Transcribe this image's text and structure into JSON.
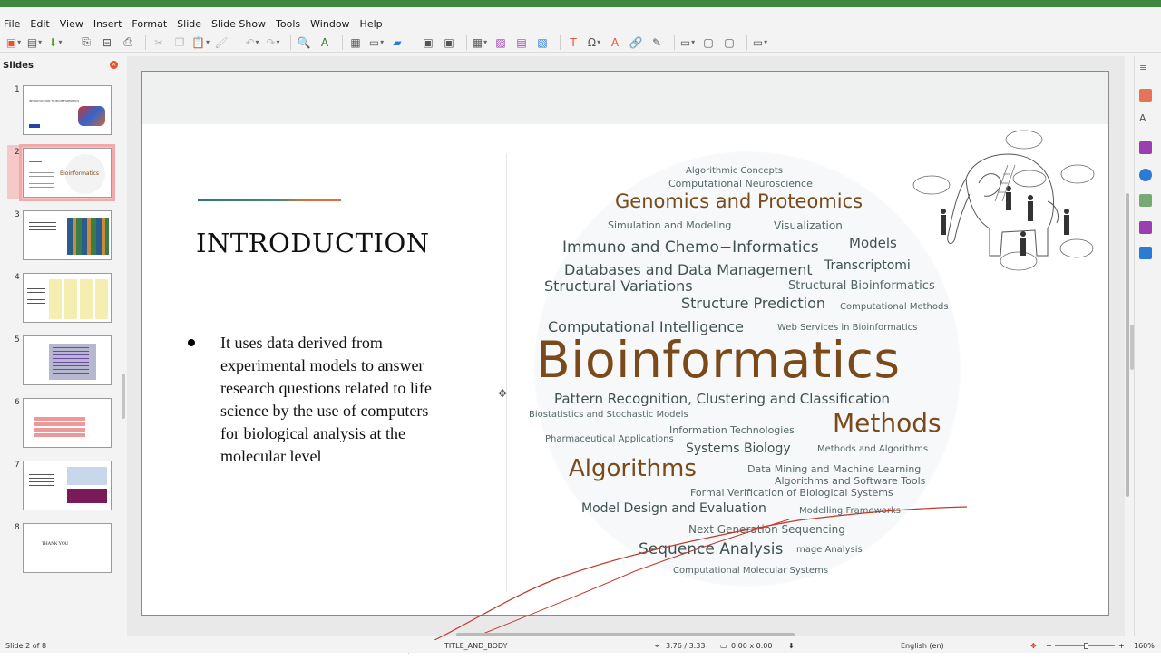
{
  "menu": [
    "File",
    "Edit",
    "View",
    "Insert",
    "Format",
    "Slide",
    "Slide Show",
    "Tools",
    "Window",
    "Help"
  ],
  "slides_panel": {
    "title": "Slides",
    "numbers": [
      "1",
      "2",
      "3",
      "4",
      "5",
      "6",
      "7",
      "8"
    ],
    "thumb8_text": "THANK YOU",
    "thumb2_text": "Bioinformatics",
    "thumb1_text": "INTRODUCTION TO BIOINFORMATICS"
  },
  "slide": {
    "title": "INTRODUCTION",
    "body": "It uses data derived from experimental models to answer research questions related to life science by the use of computers for biological analysis at the molecular level"
  },
  "wordcloud": {
    "w1": "Algorithmic Concepts",
    "w2": "Computational Neuroscience",
    "w3": "Genomics and Proteomics",
    "w4": "Simulation and Modeling",
    "w5": "Visualization",
    "w6": "Immuno and Chemo−Informatics",
    "w7": "Models",
    "w8": "Transcriptomi",
    "w9": "Databases and Data Management",
    "w10": "Structural Variations",
    "w11": "Structural Bioinformatics",
    "w12": "Structure Prediction",
    "w13": "Computational Methods",
    "w14": "Computational Intelligence",
    "w15": "Web Services in Bioinformatics",
    "w16": "Bioinformatics",
    "w17": "Pattern Recognition, Clustering and Classification",
    "w18": "Biostatistics and Stochastic Models",
    "w19": "Methods",
    "w20": "Information Technologies",
    "w21": "Pharmaceutical Applications",
    "w22": "Systems Biology",
    "w23": "Methods and Algorithms",
    "w24": "Algorithms",
    "w25": "Data Mining and Machine Learning",
    "w26": "Algorithms and Software Tools",
    "w27": "Formal Verification of Biological Systems",
    "w28": "Model Design and Evaluation",
    "w29": "Modelling Frameworks",
    "w30": "Next Generation Sequencing",
    "w31": "Sequence Analysis",
    "w32": "Image Analysis",
    "w33": "Computational Molecular Systems"
  },
  "status": {
    "slide_of": "Slide 2 of 8",
    "layout": "TITLE_AND_BODY",
    "position": "3.76 / 3.33",
    "size": "0.00 x 0.00",
    "language": "English (en)",
    "zoom": "160%"
  },
  "colors": {
    "accent_green": "#3f8a3f",
    "wordcloud_brown": "#7a4a1a",
    "wordcloud_teal": "#556666",
    "pen_red": "#c0392b"
  }
}
